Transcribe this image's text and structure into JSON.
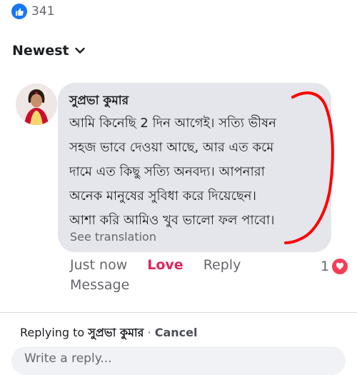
{
  "reactions_summary": {
    "count": "341",
    "icon": "like-icon"
  },
  "sort": {
    "label": "Newest",
    "icon": "chevron-down-icon"
  },
  "comment": {
    "author": "সুপ্রভা কুমার",
    "lines": [
      "আমি কিনেছি 2 দিন আগেই। সত্যি ভীষন",
      "সহজ ভাবে দেওয়া আছে, আর এত কমে",
      "দামে এত কিছু সত্যি অনবদ্য। আপনারা",
      "অনেক মানুষের সুবিধা করে দিয়েছেন।",
      "আশা করি আমিও খুব ভালো ফল পাবো।"
    ],
    "see_translation": "See translation",
    "annotation_color": "#ff0000"
  },
  "actions": {
    "time": "Just now",
    "love": "Love",
    "reply": "Reply",
    "message": "Message",
    "reaction_count": "1",
    "reaction_icon": "love-icon",
    "love_color": "#e0245e"
  },
  "reply_bar": {
    "prefix": "Replying to ",
    "name": "সুপ্রভা কুমার",
    "separator": " · ",
    "cancel": "Cancel"
  },
  "composer": {
    "placeholder": "Write a reply..."
  }
}
